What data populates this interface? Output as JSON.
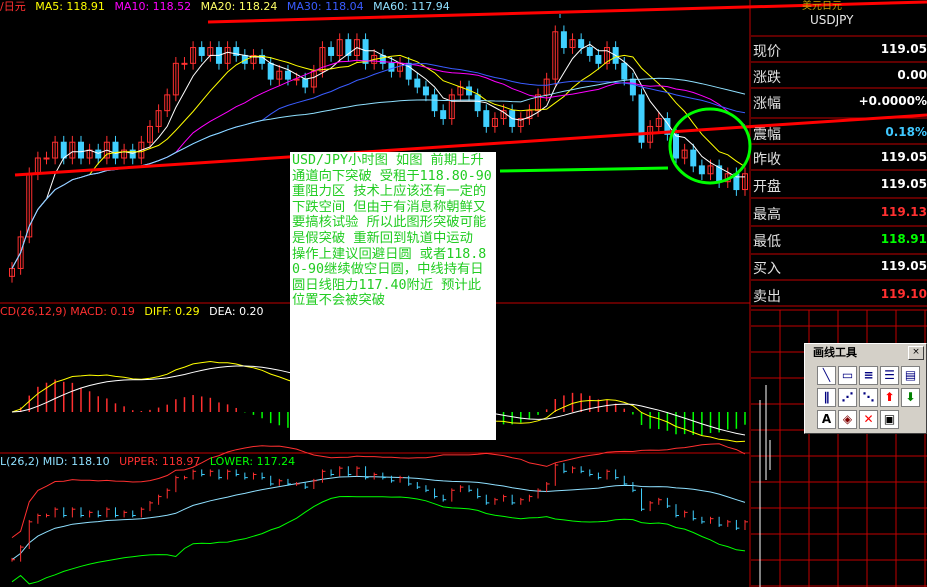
{
  "legends": {
    "top": [
      {
        "text": "/日元",
        "color": "#ff3030"
      },
      {
        "text": "MA5: 118.91",
        "color": "#ffff00"
      },
      {
        "text": "MA10: 118.52",
        "color": "#ff00ff"
      },
      {
        "text": "MA20: 118.24",
        "color": "#ffff66"
      },
      {
        "text": "MA30: 118.04",
        "color": "#3a5cff"
      },
      {
        "text": "MA60: 117.94",
        "color": "#8fe0ff"
      }
    ],
    "macd": [
      {
        "text": "CD(26,12,9) MACD: 0.19",
        "color": "#ff3030"
      },
      {
        "text": "DIFF: 0.29",
        "color": "#ffff00"
      },
      {
        "text": "DEA: 0.20",
        "color": "#ffffff"
      }
    ],
    "boll": [
      {
        "text": "L(26,2) MID: 118.10",
        "color": "#8fe0ff"
      },
      {
        "text": "UPPER: 118.97",
        "color": "#ff3030"
      },
      {
        "text": "LOWER: 117.24",
        "color": "#00ff00"
      }
    ]
  },
  "sidebar": {
    "header_top": "美元日元",
    "symbol": "USDJPY",
    "quotes": [
      {
        "label": "现价",
        "value": "119.05",
        "color": "#ffffff"
      },
      {
        "label": "涨跌",
        "value": "0.00",
        "color": "#ffffff"
      },
      {
        "label": "涨幅",
        "value": "+0.0000%",
        "color": "#ffffff"
      },
      {
        "label": "震幅",
        "value": "0.18%",
        "color": "#40c8ff"
      },
      {
        "label": "昨收",
        "value": "119.05",
        "color": "#ffffff"
      },
      {
        "label": "开盘",
        "value": "119.05",
        "color": "#ffffff"
      },
      {
        "label": "最高",
        "value": "119.13",
        "color": "#ff3030"
      },
      {
        "label": "最低",
        "value": "118.91",
        "color": "#00ff00"
      },
      {
        "label": "买入",
        "value": "119.05",
        "color": "#ffffff"
      },
      {
        "label": "卖出",
        "value": "119.10",
        "color": "#ff3030"
      }
    ]
  },
  "annotation": "USD/JPY小时图 如图 前期上升通道向下突破 受租于118.80-90重阻力区 技术上应该还有一定的下跌空间 但由于有消息称朝鲜又要搞核试验 所以此图形突破可能是假突破 重新回到轨道中运动 操作上建议回避日圆 或者118.80-90继续做空日圆，中线持有日圆日线阻力117.40附近 预计此位置不会被突破",
  "toolbox": {
    "title": "画线工具",
    "close": "×",
    "tools": [
      {
        "name": "line-tool-icon",
        "glyph": "╲",
        "color": "#000080"
      },
      {
        "name": "rect-tool-icon",
        "glyph": "▭",
        "color": "#000080"
      },
      {
        "name": "parallel-lines-tool-icon",
        "glyph": "≡",
        "color": "#000080"
      },
      {
        "name": "grid-lines-tool-icon",
        "glyph": "☰",
        "color": "#000080"
      },
      {
        "name": "fib-tool-icon",
        "glyph": "▤",
        "color": "#000080"
      },
      {
        "name": "channel-tool-icon",
        "glyph": "∥",
        "color": "#000080"
      },
      {
        "name": "gann-tool-icon",
        "glyph": "⋰",
        "color": "#000080"
      },
      {
        "name": "fan-tool-icon",
        "glyph": "⋱",
        "color": "#000080"
      },
      {
        "name": "up-arrow-tool-icon",
        "glyph": "⬆",
        "color": "#ff0000"
      },
      {
        "name": "down-arrow-tool-icon",
        "glyph": "⬇",
        "color": "#008000"
      },
      {
        "name": "text-tool-icon",
        "glyph": "A",
        "color": "#000000"
      },
      {
        "name": "eraser-tool-icon",
        "glyph": "◈",
        "color": "#800000"
      },
      {
        "name": "delete-tool-icon",
        "glyph": "✕",
        "color": "#ff0000"
      },
      {
        "name": "save-tool-icon",
        "glyph": "▣",
        "color": "#000000"
      }
    ]
  },
  "chart_data": {
    "type": "line",
    "price": {
      "ylim": [
        117.4,
        119.2
      ],
      "closes": [
        117.6,
        117.8,
        118.2,
        118.3,
        118.3,
        118.4,
        118.3,
        118.4,
        118.3,
        118.35,
        118.3,
        118.4,
        118.3,
        118.35,
        118.3,
        118.4,
        118.5,
        118.6,
        118.7,
        118.9,
        118.9,
        119.0,
        118.95,
        119.0,
        118.9,
        119.0,
        118.95,
        118.9,
        118.95,
        118.9,
        118.8,
        118.85,
        118.8,
        118.8,
        118.75,
        118.85,
        119.0,
        118.95,
        119.05,
        118.95,
        119.05,
        118.9,
        118.95,
        118.9,
        118.85,
        118.9,
        118.8,
        118.75,
        118.7,
        118.6,
        118.55,
        118.7,
        118.75,
        118.7,
        118.6,
        118.5,
        118.55,
        118.6,
        118.5,
        118.55,
        118.6,
        118.7,
        118.8,
        119.1,
        119.0,
        119.05,
        119.0,
        118.95,
        118.9,
        119.0,
        118.9,
        118.8,
        118.7,
        118.4,
        118.5,
        118.55,
        118.45,
        118.3,
        118.35,
        118.25,
        118.2,
        118.25,
        118.15,
        118.2,
        118.1,
        118.2
      ]
    },
    "macd": {
      "ylim": [
        -0.5,
        0.5
      ]
    },
    "boll": {
      "ylim": [
        117.2,
        119.1
      ]
    },
    "trendlines": [
      {
        "name": "upper-channel",
        "color": "#ff0000"
      },
      {
        "name": "lower-channel",
        "color": "#ff0000"
      },
      {
        "name": "support-line",
        "color": "#00ff00"
      }
    ]
  }
}
